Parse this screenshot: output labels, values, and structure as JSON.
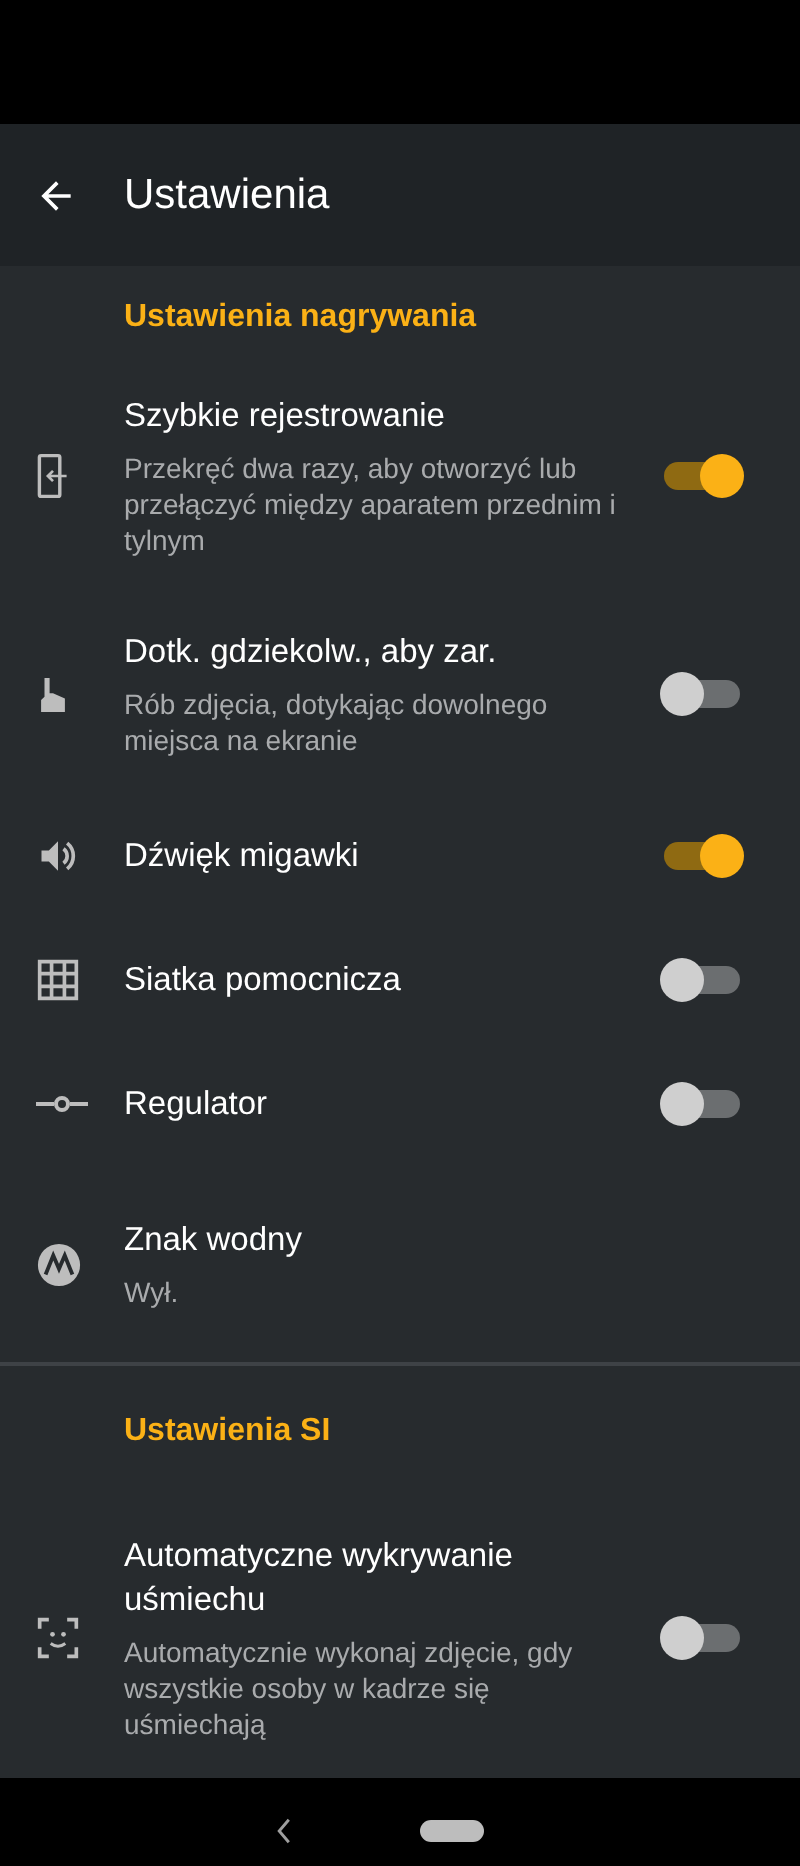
{
  "header": {
    "title": "Ustawienia"
  },
  "sections": [
    {
      "title": "Ustawienia nagrywania",
      "items": [
        {
          "kind": "toggle",
          "title": "Szybkie rejestrowanie",
          "subtitle": "Przekręć dwa razy, aby otworzyć lub przełączyć między aparatem przednim i tylnym",
          "on": true
        },
        {
          "kind": "toggle",
          "title": "Dotk. gdziekolw., aby zar.",
          "subtitle": "Rób zdjęcia, dotykając dowolnego miejsca na ekranie",
          "on": false
        },
        {
          "kind": "toggle",
          "title": "Dźwięk migawki",
          "on": true
        },
        {
          "kind": "toggle",
          "title": "Siatka pomocnicza",
          "on": false
        },
        {
          "kind": "toggle",
          "title": "Regulator",
          "on": false
        },
        {
          "kind": "value",
          "title": "Znak wodny",
          "subtitle": "Wył."
        }
      ]
    },
    {
      "title": "Ustawienia SI",
      "items": [
        {
          "kind": "toggle",
          "title": "Automatyczne wykrywanie uśmiechu",
          "subtitle": "Automatycznie wykonaj zdjęcie, gdy wszystkie osoby w kadrze się uśmiechają",
          "on": false
        }
      ]
    }
  ]
}
